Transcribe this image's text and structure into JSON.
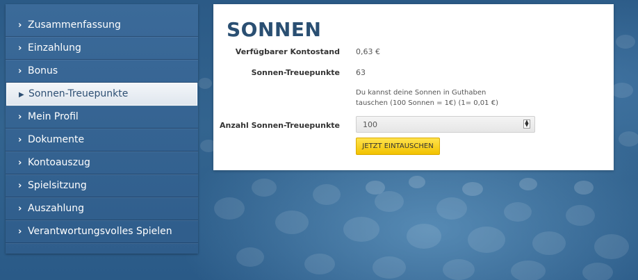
{
  "sidebar": {
    "items": [
      {
        "label": "Zusammenfassung",
        "active": false
      },
      {
        "label": "Einzahlung",
        "active": false
      },
      {
        "label": "Bonus",
        "active": false
      },
      {
        "label": "Sonnen-Treuepunkte",
        "active": true
      },
      {
        "label": "Mein Profil",
        "active": false
      },
      {
        "label": "Dokumente",
        "active": false
      },
      {
        "label": "Kontoauszug",
        "active": false
      },
      {
        "label": "Spielsitzung",
        "active": false
      },
      {
        "label": "Auszahlung",
        "active": false
      },
      {
        "label": "Verantwortungsvolles Spielen",
        "active": false
      }
    ]
  },
  "panel": {
    "title": "SONNEN",
    "balance_label": "Verfügbarer Kontostand",
    "balance_value": "0,63 €",
    "points_label": "Sonnen-Treuepunkte",
    "points_value": "63",
    "note_line1": "Du kannst deine Sonnen in Guthaben",
    "note_line2": "tauschen (100 Sonnen = 1€) (1= 0,01 €)",
    "amount_label": "Anzahl Sonnen-Treuepunkte",
    "amount_value": "100",
    "exchange_button": "JETZT EINTAUSCHEN"
  },
  "colors": {
    "accent_title": "#2a4f72",
    "button_yellow": "#f2c200",
    "sidebar_bg": "#2f5d8b"
  }
}
